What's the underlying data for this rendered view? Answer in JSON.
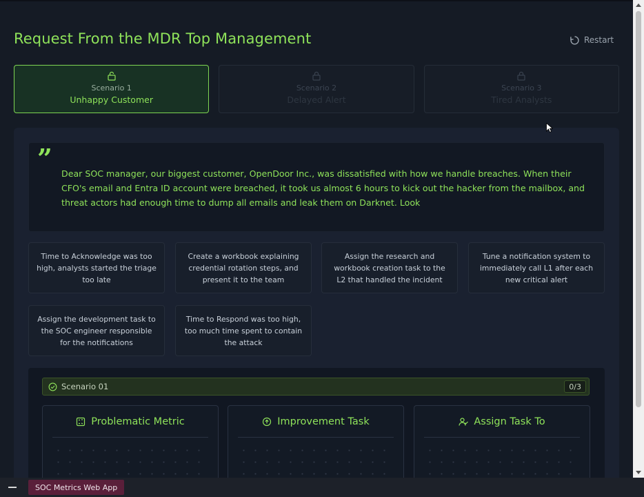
{
  "page": {
    "title": "Request From the MDR Top Management",
    "restart_label": "Restart"
  },
  "tabs": [
    {
      "number": "Scenario 1",
      "name": "Unhappy Customer",
      "active": true
    },
    {
      "number": "Scenario 2",
      "name": "Delayed Alert",
      "active": false
    },
    {
      "number": "Scenario 3",
      "name": "Tired Analysts",
      "active": false
    }
  ],
  "quote": {
    "text": "Dear SOC manager, our biggest customer, OpenDoor Inc., was dissatisfied with how we handle breaches. When their CFO's email and Entra ID account were breached, it took us almost 6 hours to kick out the hacker from the mailbox, and threat actors had enough time to dump all emails and leak them on Darknet. Look"
  },
  "cards": [
    "Time to Acknowledge was too high, analysts started the triage too late",
    "Create a workbook explaining credential rotation steps, and present it to the team",
    "Assign the research and workbook creation task to the L2 that handled the incident",
    "Tune a notification system to immediately call L1 after each new critical alert",
    "Assign the development task to the SOC engineer responsible for the notifications",
    "Time to Respond was too high, too much time spent to contain the attack"
  ],
  "scenario": {
    "label": "Scenario 01",
    "counter": "0/3",
    "columns": [
      {
        "title": "Problematic Metric",
        "icon": "metric-icon"
      },
      {
        "title": "Improvement Task",
        "icon": "task-icon"
      },
      {
        "title": "Assign Task To",
        "icon": "user-icon"
      }
    ]
  },
  "taskbar": {
    "app_label": "SOC Metrics Web App"
  },
  "colors": {
    "accent": "#8fe35a",
    "background": "#151b25",
    "active_tab": "#183224",
    "taskbar_app": "#5a1f3a"
  }
}
